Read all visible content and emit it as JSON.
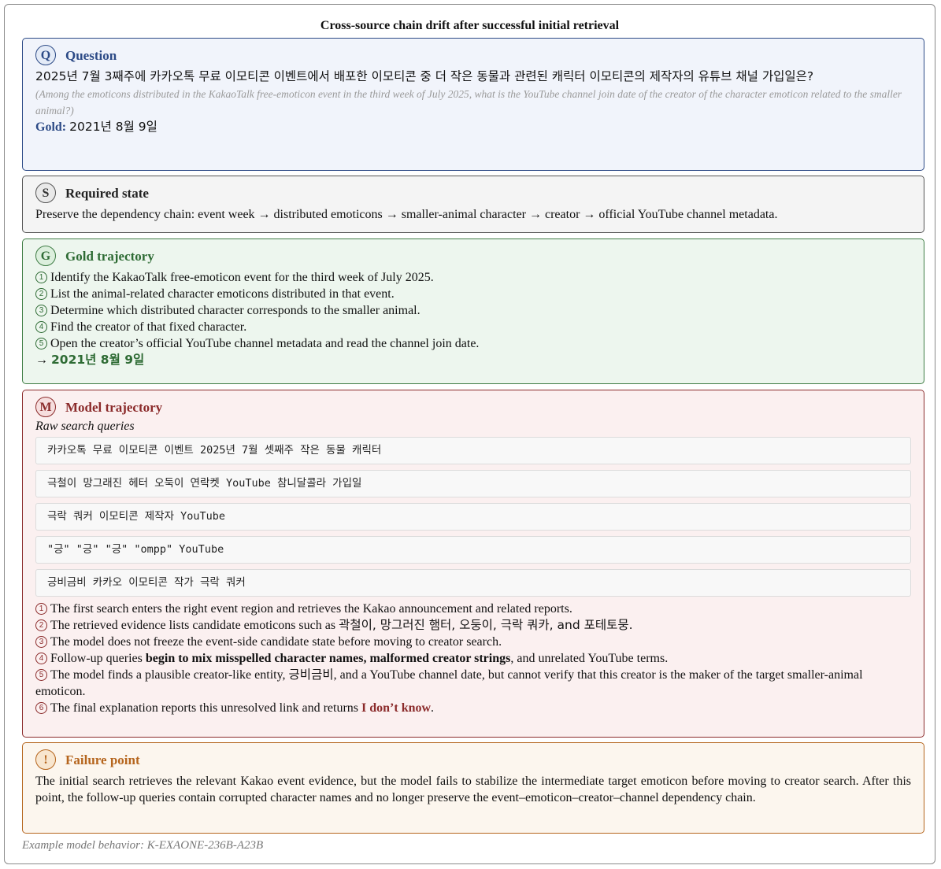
{
  "title": "Cross-source chain drift after successful initial retrieval",
  "question": {
    "badge": "Q",
    "label": "Question",
    "text_ko": "2025년 7월 3째주에 카카오톡 무료 이모티콘 이벤트에서 배포한 이모티콘 중 더 작은 동물과 관련된 캐릭터 이모티콘의 제작자의 유튜브 채널 가입일은?",
    "translation": "(Among the emoticons distributed in the KakaoTalk free-emoticon event in the third week of July 2025, what is the YouTube channel join date of the creator of the character emoticon related to the smaller animal?)",
    "gold_label": "Gold:",
    "gold_value": "2021년 8월 9일"
  },
  "required_state": {
    "badge": "S",
    "label": "Required state",
    "text": "Preserve the dependency chain: event week → distributed emoticons → smaller-animal character → creator → official YouTube channel metadata."
  },
  "gold_trajectory": {
    "badge": "G",
    "label": "Gold trajectory",
    "steps": [
      {
        "num": "1",
        "text": "Identify the KakaoTalk free-emoticon event for the third week of July 2025."
      },
      {
        "num": "2",
        "text": "List the animal-related character emoticons distributed in that event."
      },
      {
        "num": "3",
        "text": "Determine which distributed character corresponds to the smaller animal."
      },
      {
        "num": "4",
        "text": "Find the creator of that fixed character."
      },
      {
        "num": "5",
        "text": "Open the creator’s official YouTube channel metadata and read the channel join date."
      }
    ],
    "arrow": "→",
    "answer": "2021년 8월 9일"
  },
  "model_trajectory": {
    "badge": "M",
    "label": "Model trajectory",
    "raw_label": "Raw search queries",
    "queries": [
      "카카오톡 무료 이모티콘 이벤트 2025년 7월 셋째주 작은 동물 캐릭터",
      "극철이 망그래진 헤터 오둑이 연락켓 YouTube 참니달콜라 가입일",
      "극락 쿼커 이모티콘 제작자 YouTube",
      "\"긍\" \"긍\" \"긍\" \"ompp\" YouTube",
      "긍비금비 카카오 이모티콘 작가 극락 쿼커"
    ],
    "steps": {
      "s1": {
        "num": "1",
        "text": "The first search enters the right event region and retrieves the Kakao announcement and related reports."
      },
      "s2": {
        "num": "2",
        "pre": "The retrieved evidence lists candidate emoticons such as ",
        "ko": "곽철이, 망그러진 햄터, 오둥이, 극락 쿼카,",
        "post": " and 포테토뭉."
      },
      "s3": {
        "num": "3",
        "text": "The model does not freeze the event-side candidate state before moving to creator search."
      },
      "s4": {
        "num": "4",
        "pre": "Follow-up queries ",
        "bold": "begin to mix misspelled character names, malformed creator strings",
        "post": ", and unrelated YouTube terms."
      },
      "s5": {
        "num": "5",
        "pre": "The model finds a plausible creator-like entity, ",
        "ko": "긍비금비",
        "post": ", and a YouTube channel date, but cannot verify that this creator is the maker of the target smaller-animal emoticon."
      },
      "s6": {
        "num": "6",
        "pre": "The final explanation reports this unresolved link and returns ",
        "idk": "I don’t know",
        "post": "."
      }
    }
  },
  "failure_point": {
    "badge": "!",
    "label": "Failure point",
    "text": "The initial search retrieves the relevant Kakao event evidence, but the model fails to stabilize the intermediate target emoticon before moving to creator search. After this point, the follow-up queries contain corrupted character names and no longer preserve the event–emoticon–creator–channel dependency chain."
  },
  "footer": "Example model behavior: K-EXAONE-236B-A23B",
  "colors": {
    "question": "#2c4a86",
    "gold": "#3f7d45",
    "model": "#8b2b2b",
    "failure": "#b5651d"
  }
}
